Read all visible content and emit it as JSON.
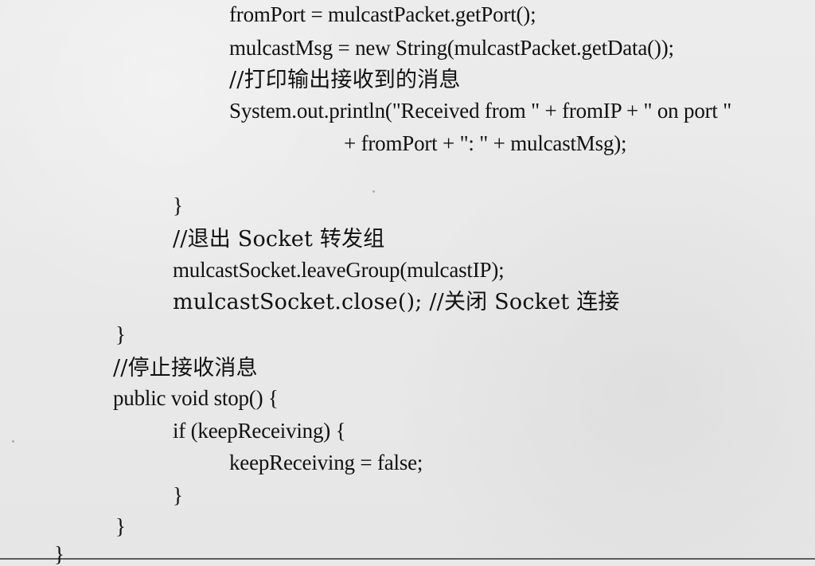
{
  "document": {
    "lines": [
      "fromPort = mulcastPacket.getPort();",
      "mulcastMsg = new String(mulcastPacket.getData());",
      "//打印输出接收到的消息",
      "System.out.println(\"Received from \" + fromIP + \" on port \"",
      "+ fromPort + \": \" + mulcastMsg);",
      "}",
      "//退出 Socket 转发组",
      "mulcastSocket.leaveGroup(mulcastIP);",
      "mulcastSocket.close(); //关闭 Socket 连接",
      "}",
      "//停止接收消息",
      "public void stop() {",
      "if (keepReceiving) {",
      "keepReceiving = false;",
      "}",
      "}",
      "}"
    ]
  }
}
